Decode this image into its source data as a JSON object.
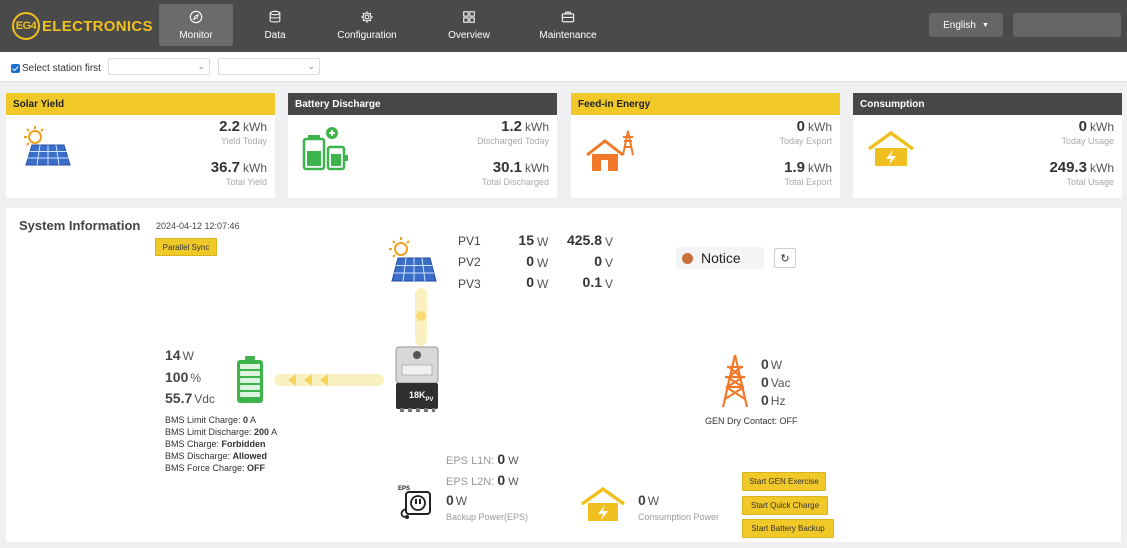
{
  "header": {
    "logo_badge": "EG4",
    "logo_text": "ELECTRONICS",
    "nav": [
      {
        "label": "Monitor",
        "icon": "compass-icon",
        "active": true
      },
      {
        "label": "Data",
        "icon": "database-icon"
      },
      {
        "label": "Configuration",
        "icon": "gear-icon"
      },
      {
        "label": "Overview",
        "icon": "grid-icon"
      },
      {
        "label": "Maintenance",
        "icon": "toolbox-icon"
      }
    ],
    "language": "English"
  },
  "station_bar": {
    "checkbox_label": "Select station first",
    "checked": true
  },
  "cards": [
    {
      "title": "Solar Yield",
      "style": "yellow",
      "icon": "solar-panel-icon",
      "v1": "2.2",
      "u1": "kWh",
      "l1": "Yield Today",
      "v2": "36.7",
      "u2": "kWh",
      "l2": "Total Yield"
    },
    {
      "title": "Battery Discharge",
      "style": "dark",
      "icon": "battery-icon",
      "v1": "1.2",
      "u1": "kWh",
      "l1": "Discharged Today",
      "v2": "30.1",
      "u2": "kWh",
      "l2": "Total Discharged"
    },
    {
      "title": "Feed-in Energy",
      "style": "yellow",
      "icon": "house-grid-icon",
      "v1": "0",
      "u1": "kWh",
      "l1": "Today Export",
      "v2": "1.9",
      "u2": "kWh",
      "l2": "Total Export"
    },
    {
      "title": "Consumption",
      "style": "dark",
      "icon": "house-bolt-icon",
      "v1": "0",
      "u1": "kWh",
      "l1": "Today Usage",
      "v2": "249.3",
      "u2": "kWh",
      "l2": "Total Usage"
    }
  ],
  "system": {
    "title": "System Information",
    "timestamp": "2024-04-12 12:07:46",
    "parallel_sync": "Parallel Sync",
    "pv": [
      {
        "name": "PV1",
        "power": "15",
        "power_unit": "W",
        "voltage": "425.8",
        "voltage_unit": "V"
      },
      {
        "name": "PV2",
        "power": "0",
        "power_unit": "W",
        "voltage": "0",
        "voltage_unit": "V"
      },
      {
        "name": "PV3",
        "power": "0",
        "power_unit": "W",
        "voltage": "0.1",
        "voltage_unit": "V"
      }
    ],
    "notice": "Notice",
    "battery": {
      "power": "14",
      "power_unit": "W",
      "soc": "100",
      "soc_unit": "%",
      "voltage": "55.7",
      "voltage_unit": "Vdc",
      "bms": [
        {
          "label": "BMS Limit Charge: ",
          "value": "0",
          "unit": " A"
        },
        {
          "label": "BMS Limit Discharge: ",
          "value": "200",
          "unit": " A"
        },
        {
          "label": "BMS Charge: ",
          "value": "Forbidden",
          "unit": ""
        },
        {
          "label": "BMS Discharge: ",
          "value": "Allowed",
          "unit": ""
        },
        {
          "label": "BMS Force Charge: ",
          "value": "OFF",
          "unit": ""
        }
      ]
    },
    "inverter_label": "18K",
    "inverter_sub": "PV",
    "generator": {
      "power": "0",
      "power_unit": "W",
      "voltage": "0",
      "voltage_unit": "Vac",
      "freq": "0",
      "freq_unit": "Hz",
      "dry_contact": "GEN Dry Contact: OFF"
    },
    "eps": {
      "l1_label": "EPS L1N:",
      "l1_value": "0",
      "l1_unit": "W",
      "l2_label": "EPS L2N:",
      "l2_value": "0",
      "l2_unit": "W",
      "backup_value": "0",
      "backup_unit": "W",
      "backup_label": "Backup Power(EPS)",
      "icon_text": "EPS"
    },
    "consumption": {
      "value": "0",
      "unit": "W",
      "label": "Consumption Power"
    },
    "actions": [
      "Start GEN Exercise",
      "Start Quick Charge",
      "Start Battery Backup"
    ]
  },
  "colors": {
    "brand_yellow": "#f0c929",
    "header_dark": "#4a4a4a",
    "battery_green": "#3cb44b",
    "grid_orange": "#f07a2a",
    "notice_dot": "#c8703a"
  }
}
